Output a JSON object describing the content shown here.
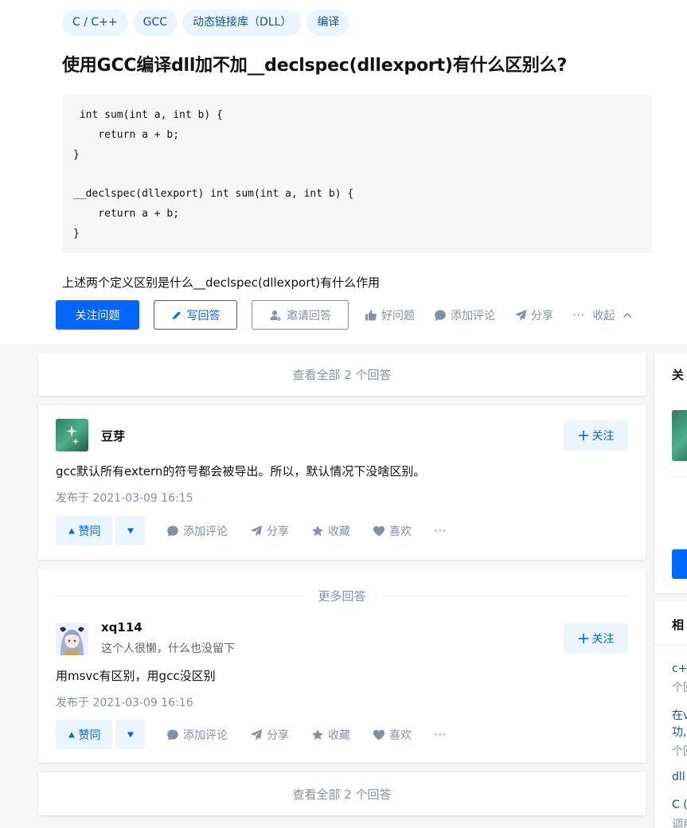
{
  "question": {
    "topics": [
      "C / C++",
      "GCC",
      "动态链接库（DLL）",
      "编译"
    ],
    "title": "使用GCC编译dll加不加__declspec(dllexport)有什么区别么?",
    "code": " int sum(int a, int b) {\n    return a + b;\n}\n\n__declspec(dllexport) int sum(int a, int b) {\n    return a + b;\n}",
    "description": "上述两个定义区别是什么__declspec(dllexport)有什么作用",
    "actions": {
      "follow_label": "关注问题",
      "write_answer_label": "写回答",
      "invite_label": "邀请回答",
      "good_question_label": "好问题",
      "comment_label": "添加评论",
      "share_label": "分享",
      "more_label": "···",
      "collapse_label": "收起"
    }
  },
  "view_all_label": "查看全部 2 个回答",
  "more_answers_label": "更多回答",
  "answers": [
    {
      "author": "豆芽",
      "headline": "",
      "follow_label": "关注",
      "content": "gcc默认所有extern的符号都会被导出。所以，默认情况下没啥区别。",
      "time": "发布于 2021-03-09 16:15",
      "vote_label": "赞同",
      "comment_label": "添加评论",
      "share_label": "分享",
      "collect_label": "收藏",
      "like_label": "喜欢",
      "more_label": "···"
    },
    {
      "author": "xq114",
      "headline": "这个人很懒，什么也没留下",
      "follow_label": "关注",
      "content": "用msvc有区别，用gcc没区别",
      "time": "发布于 2021-03-09 16:16",
      "vote_label": "赞同",
      "comment_label": "添加评论",
      "share_label": "分享",
      "collect_label": "收藏",
      "like_label": "喜欢",
      "more_label": "···"
    }
  ],
  "sidebar": {
    "card1_title": "关",
    "card2_title": "相",
    "related": [
      {
        "line1": "c+",
        "line2": "个回"
      },
      {
        "line1": "在v",
        "line2": "功,",
        "line3": "个回"
      },
      {
        "line1": "dll"
      },
      {
        "line1": "C (",
        "line2": "调用"
      }
    ]
  },
  "colors": {
    "primary": "#0066ff",
    "primary_light": "#ebf5ff",
    "topic_text": "#175199",
    "muted": "#8590a6"
  }
}
